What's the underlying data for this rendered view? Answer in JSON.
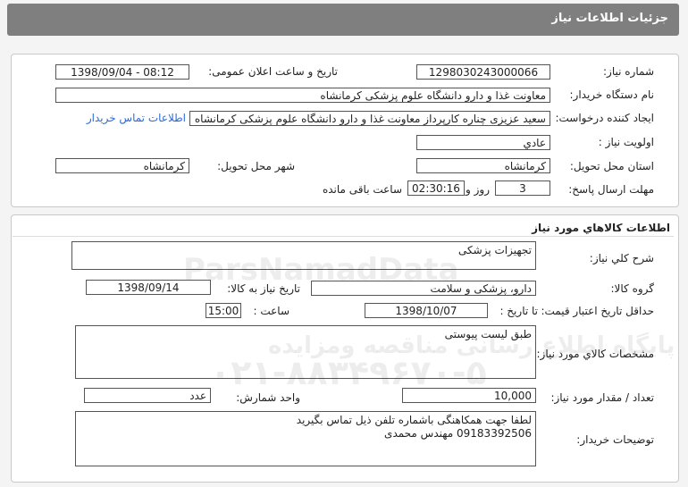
{
  "window": {
    "title": "جزئيات اطلاعات نياز"
  },
  "general": {
    "need_number_label": "شماره نياز:",
    "need_number": "1298030243000066",
    "announce_label": "تاريخ و ساعت اعلان عمومی:",
    "announce_value": "1398/09/04 - 08:12",
    "buyer_org_label": "نام دستگاه خريدار:",
    "buyer_org": "معاونت غذا و دارو دانشگاه علوم پزشکی کرمانشاه",
    "creator_label": "ايجاد کننده درخواست:",
    "creator": "سعيد عزيزی چناره کارپرداز معاونت غذا و دارو دانشگاه علوم پزشکی کرمانشاه",
    "contact_link": "اطلاعات تماس خريدار",
    "priority_label": "اولويت نياز :",
    "priority": "عادي",
    "province_label": "استان محل تحويل:",
    "province": "کرمانشاه",
    "city_label": "شهر محل تحويل:",
    "city": "کرمانشاه",
    "deadline_label": "مهلت ارسال پاسخ:",
    "days": "3",
    "days_label": "روز و",
    "time": "02:30:16",
    "remaining_label": "ساعت باقی مانده"
  },
  "goods": {
    "section_title": "اطلاعات کالاهاي مورد نياز",
    "summary_label": "شرح کلي نياز:",
    "summary": "تجهيزات پزشکی",
    "group_label": "گروه کالا:",
    "group": "دارو، پزشکی و سلامت",
    "need_date_label": "تاريخ نياز به کالا:",
    "need_date": "1398/09/14",
    "validity_label": "حداقل تاريخ اعتبار قيمت:",
    "until_date_label": "تا تاريخ :",
    "until_date": "1398/10/07",
    "hour_label": "ساعت :",
    "hour": "15:00",
    "specs_label": "مشخصات کالاي مورد نياز:",
    "specs": "طبق ليست پيوستی",
    "qty_label": "تعداد / مقدار مورد نياز:",
    "qty": "10,000",
    "unit_label": "واحد شمارش:",
    "unit": "عدد",
    "desc_label": "توضيحات خريدار:",
    "desc_line1": "لطفا جهت همکاهنگی باشماره تلفن ذيل تماس بگيريد",
    "desc_line2": "09183392506 مهندس محمدی"
  },
  "watermark": {
    "brand": "ParsNamadData",
    "line1": "پايگاه اطلاع رسانی مناقصه ومزايده",
    "line2": "۰۲۱-۸۸۳۴۹۶۷۰-۵"
  },
  "colors": {
    "titlebar": "#7f7f7f",
    "link": "#2a6ad8"
  }
}
